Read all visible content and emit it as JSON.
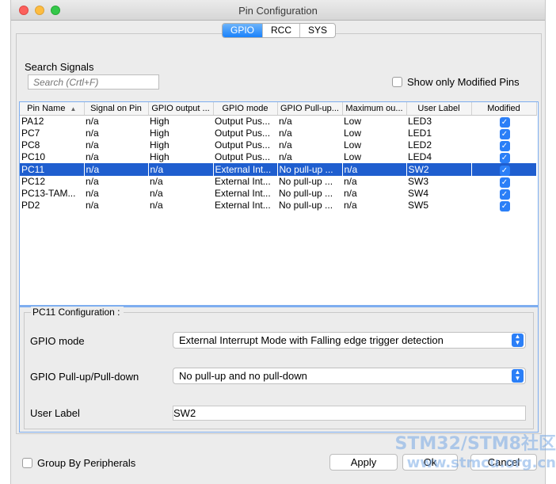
{
  "window": {
    "title": "Pin Configuration"
  },
  "tabs": [
    {
      "label": "GPIO",
      "active": true
    },
    {
      "label": "RCC",
      "active": false
    },
    {
      "label": "SYS",
      "active": false
    }
  ],
  "search": {
    "label": "Search Signals",
    "placeholder": "Search (Crtl+F)"
  },
  "show_modified": {
    "label": "Show only Modified Pins",
    "checked": false
  },
  "table": {
    "columns": [
      "Pin Name",
      "Signal on Pin",
      "GPIO output ...",
      "GPIO mode",
      "GPIO Pull-up...",
      "Maximum ou...",
      "User Label",
      "Modified"
    ],
    "rows": [
      {
        "pin": "PA12",
        "signal": "n/a",
        "output": "High",
        "mode": "Output Pus...",
        "pull": "n/a",
        "speed": "Low",
        "label": "LED3",
        "modified": true
      },
      {
        "pin": "PC7",
        "signal": "n/a",
        "output": "High",
        "mode": "Output Pus...",
        "pull": "n/a",
        "speed": "Low",
        "label": "LED1",
        "modified": true
      },
      {
        "pin": "PC8",
        "signal": "n/a",
        "output": "High",
        "mode": "Output Pus...",
        "pull": "n/a",
        "speed": "Low",
        "label": "LED2",
        "modified": true
      },
      {
        "pin": "PC10",
        "signal": "n/a",
        "output": "High",
        "mode": "Output Pus...",
        "pull": "n/a",
        "speed": "Low",
        "label": "LED4",
        "modified": true
      },
      {
        "pin": "PC11",
        "signal": "n/a",
        "output": "n/a",
        "mode": "External Int...",
        "pull": "No pull-up ...",
        "speed": "n/a",
        "label": "SW2",
        "modified": true
      },
      {
        "pin": "PC12",
        "signal": "n/a",
        "output": "n/a",
        "mode": "External Int...",
        "pull": "No pull-up ...",
        "speed": "n/a",
        "label": "SW3",
        "modified": true
      },
      {
        "pin": "PC13-TAM...",
        "signal": "n/a",
        "output": "n/a",
        "mode": "External Int...",
        "pull": "No pull-up ...",
        "speed": "n/a",
        "label": "SW4",
        "modified": true
      },
      {
        "pin": "PD2",
        "signal": "n/a",
        "output": "n/a",
        "mode": "External Int...",
        "pull": "No pull-up ...",
        "speed": "n/a",
        "label": "SW5",
        "modified": true
      }
    ],
    "selected_row": 4
  },
  "config": {
    "title": "PC11 Configuration :",
    "gpio_mode_label": "GPIO mode",
    "gpio_mode_value": "External Interrupt Mode with Falling edge trigger detection",
    "pull_label": "GPIO Pull-up/Pull-down",
    "pull_value": "No pull-up and no pull-down",
    "user_label_label": "User Label",
    "user_label_value": "SW2"
  },
  "footer": {
    "group_by_label": "Group By Peripherals",
    "group_by_checked": false,
    "apply_label": "Apply",
    "ok_label": "Ok",
    "cancel_label": "Cancel"
  },
  "watermark": {
    "line1": "STM32/STM8社区",
    "line2": "www.stmcu.org.cn"
  },
  "icons": {
    "check": "checkmark-icon",
    "sort": "sort-ascending-icon",
    "select_arrow": "updown-chevron-icon"
  },
  "colors": {
    "selection": "#1f5ecf",
    "accent": "#2b7ff7",
    "table_border": "#7eaef0"
  }
}
